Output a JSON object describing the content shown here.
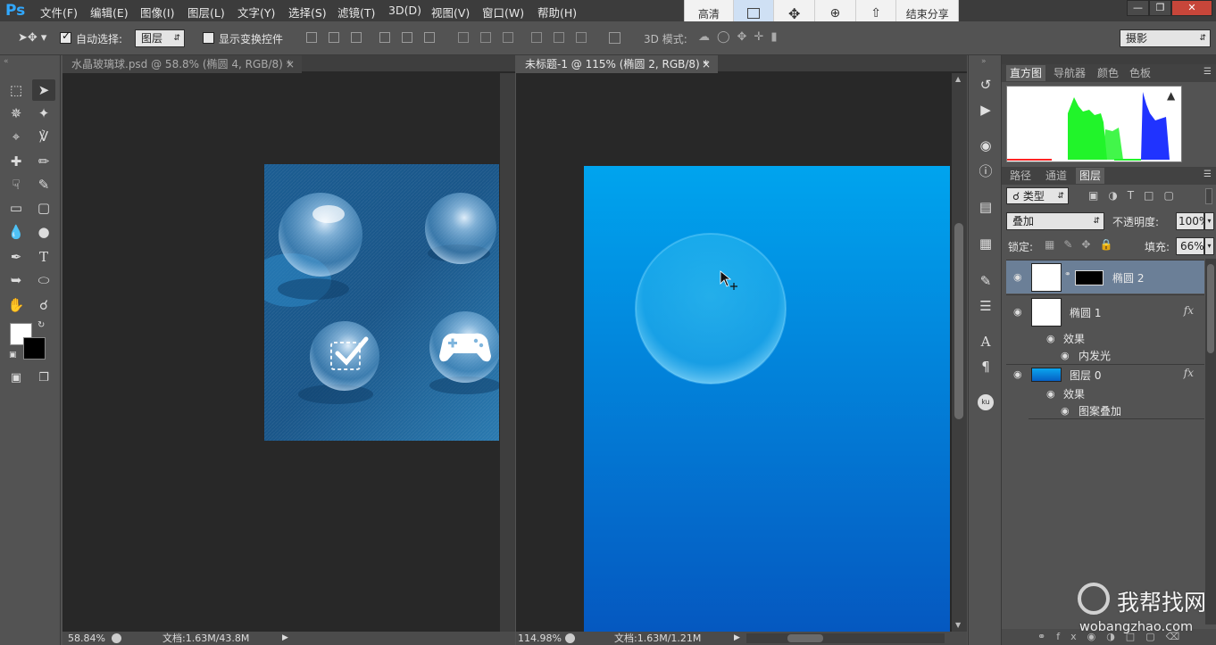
{
  "app": {
    "logo": "Ps"
  },
  "menu": [
    "文件(F)",
    "编辑(E)",
    "图像(I)",
    "图层(L)",
    "文字(Y)",
    "选择(S)",
    "滤镜(T)",
    "3D(D)",
    "视图(V)",
    "窗口(W)",
    "帮助(H)"
  ],
  "share_bar": {
    "quality": "高清",
    "end": "结束分享"
  },
  "options": {
    "auto_select_label": "自动选择:",
    "auto_select_value": "图层",
    "show_transform_label": "显示变换控件",
    "mode3d_label": "3D 模式:",
    "workspace": "摄影"
  },
  "docs": [
    {
      "tab": "水晶玻璃球.psd @ 58.8% (椭圆 4, RGB/8) *",
      "zoom": "58.84%",
      "info": "文档:1.63M/43.8M"
    },
    {
      "tab": "未标题-1 @ 115% (椭圆 2, RGB/8) *",
      "zoom": "114.98%",
      "info": "文档:1.63M/1.21M"
    }
  ],
  "top_panel_tabs": [
    "直方图",
    "导航器",
    "颜色",
    "色板"
  ],
  "layers_panel": {
    "tabs": [
      "路径",
      "通道",
      "图层"
    ],
    "filter": "类型",
    "blend": "叠加",
    "opacity_label": "不透明度:",
    "opacity_value": "100%",
    "lock_label": "锁定:",
    "fill_label": "填充:",
    "fill_value": "66%",
    "layers": [
      {
        "name": "椭圆 2"
      },
      {
        "name": "椭圆 1",
        "effects_label": "效果",
        "effect": "内发光"
      },
      {
        "name": "图层 0",
        "effects_label": "效果",
        "effect": "图案叠加"
      }
    ]
  },
  "watermark": {
    "cn": "我帮找网",
    "url": "wobangzhao.com"
  },
  "colors": {
    "accent": "#31a8ff",
    "canvas_top": "#00a4ee",
    "canvas_bottom": "#0558c0"
  }
}
